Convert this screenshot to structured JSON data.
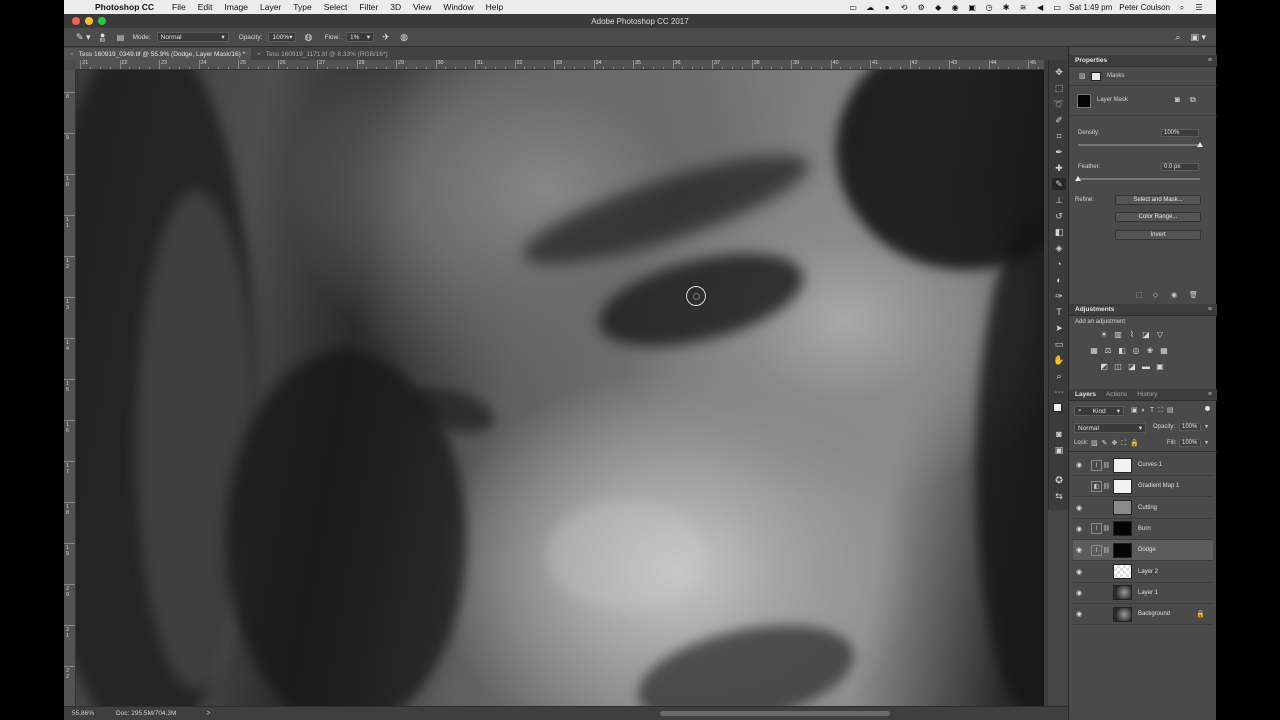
{
  "menubar": {
    "app_name": "Photoshop CC",
    "items": [
      "File",
      "Edit",
      "Image",
      "Layer",
      "Type",
      "Select",
      "Filter",
      "3D",
      "View",
      "Window",
      "Help"
    ],
    "clock": "Sat 1:49 pm",
    "user": "Peter Coulson"
  },
  "window": {
    "title": "Adobe Photoshop CC 2017"
  },
  "options": {
    "brush_size": "80",
    "mode_label": "Mode:",
    "mode_value": "Normal",
    "opacity_label": "Opacity:",
    "opacity_value": "100%",
    "flow_label": "Flow:",
    "flow_value": "1%"
  },
  "tabs": [
    {
      "label": "Tess 160919_0349.tif @ 55.9% (Dodge, Layer Mask/16) *",
      "active": true
    },
    {
      "label": "Tess 160919_1171.tif @ 8.33% (RGB/16*)",
      "active": false
    }
  ],
  "ruler": {
    "top_labels": [
      "21",
      "22",
      "23",
      "24",
      "25",
      "26",
      "27",
      "28",
      "29",
      "30",
      "31",
      "32",
      "33",
      "34",
      "35",
      "36",
      "37",
      "38",
      "39",
      "40",
      "41",
      "42",
      "43",
      "44",
      "45"
    ],
    "left_labels": [
      "8",
      "9",
      "1\n0",
      "1\n1",
      "1\n2",
      "1\n3",
      "1\n4",
      "1\n5",
      "1\n6",
      "1\n7",
      "1\n8",
      "1\n9",
      "2\n0",
      "2\n1",
      "2\n2"
    ]
  },
  "status": {
    "zoom": "55.86%",
    "doc": "Doc: 295.5M/704.3M",
    "arrow": ">"
  },
  "properties": {
    "header": "Properties",
    "subtitle": "Masks",
    "layer_mask_label": "Layer Mask",
    "density_label": "Density:",
    "density_value": "100%",
    "density": 1.0,
    "feather_label": "Feather:",
    "feather_value": "0.0 px",
    "feather": 0.0,
    "refine_label": "Refine:",
    "select_and_mask": "Select and Mask...",
    "color_range": "Color Range...",
    "invert": "Invert"
  },
  "adjustments": {
    "header": "Adjustments",
    "add_label": "Add an adjustment"
  },
  "layers_panel": {
    "tabs": [
      "Layers",
      "Actions",
      "History"
    ],
    "kind_label": "Kind",
    "blend_mode": "Normal",
    "opacity_label": "Opacity:",
    "opacity_value": "100%",
    "lock_label": "Lock:",
    "fill_label": "Fill:",
    "fill_value": "100%",
    "layers": [
      {
        "name": "Curves 1",
        "visible": true,
        "type": "adjustment",
        "selected": false
      },
      {
        "name": "Gradient Map 1",
        "visible": false,
        "type": "adjustment",
        "selected": false
      },
      {
        "name": "Cutting",
        "visible": true,
        "type": "fill",
        "selected": false
      },
      {
        "name": "Burn",
        "visible": true,
        "type": "adjustment-dark",
        "selected": false
      },
      {
        "name": "Dodge",
        "visible": true,
        "type": "adjustment-dark",
        "selected": true
      },
      {
        "name": "Layer 2",
        "visible": true,
        "type": "transparent",
        "selected": false
      },
      {
        "name": "Layer 1",
        "visible": true,
        "type": "photo",
        "selected": false
      },
      {
        "name": "Background",
        "visible": true,
        "type": "photo",
        "selected": false,
        "locked": true
      }
    ]
  },
  "colors": {
    "close": "#fc5f57",
    "minimize": "#fdbc2e",
    "maximize": "#28c840",
    "panel": "#4a4a4a",
    "panel_dark": "#3d3d3d"
  }
}
